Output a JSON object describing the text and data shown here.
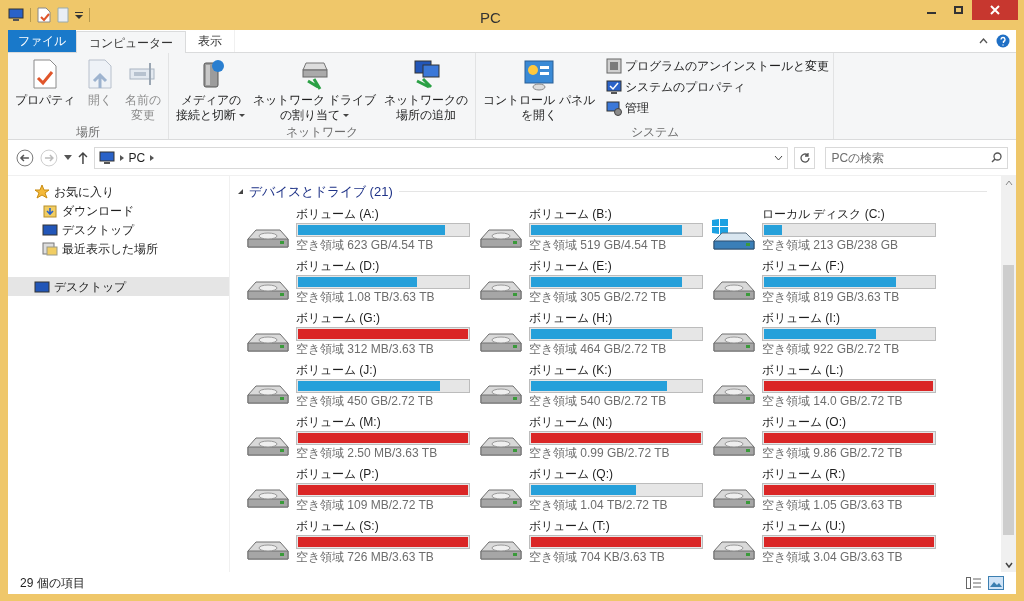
{
  "window": {
    "title": "PC"
  },
  "ribbon": {
    "tabs": [
      {
        "label": "ファイル",
        "kind": "file",
        "selected": false
      },
      {
        "label": "コンピューター",
        "kind": "tab",
        "selected": true
      },
      {
        "label": "表示",
        "kind": "tab",
        "selected": false
      }
    ],
    "groups": [
      {
        "label": "場所",
        "items": [
          {
            "lines": [
              "プロパティ"
            ],
            "kind": "large",
            "disabled": false,
            "dropdown": false
          },
          {
            "lines": [
              "開く"
            ],
            "kind": "large",
            "disabled": true,
            "dropdown": false
          },
          {
            "lines": [
              "名前の",
              "変更"
            ],
            "kind": "large",
            "disabled": true,
            "dropdown": false
          }
        ]
      },
      {
        "label": "ネットワーク",
        "items": [
          {
            "lines": [
              "メディアの",
              "接続と切断"
            ],
            "kind": "large",
            "disabled": false,
            "dropdown": true
          },
          {
            "lines": [
              "ネットワーク ドライブ",
              "の割り当て"
            ],
            "kind": "large",
            "disabled": false,
            "dropdown": true
          },
          {
            "lines": [
              "ネットワークの",
              "場所の追加"
            ],
            "kind": "large",
            "disabled": false,
            "dropdown": false
          }
        ]
      },
      {
        "label": "システム",
        "items": [
          {
            "lines": [
              "コントロール パネル",
              "を開く"
            ],
            "kind": "large",
            "disabled": false,
            "dropdown": false
          },
          {
            "lines": [
              "プログラムのアンインストールと変更"
            ],
            "kind": "small",
            "disabled": false,
            "dropdown": false
          },
          {
            "lines": [
              "システムのプロパティ"
            ],
            "kind": "small",
            "disabled": false,
            "dropdown": false
          },
          {
            "lines": [
              "管理"
            ],
            "kind": "small",
            "disabled": false,
            "dropdown": false
          }
        ]
      }
    ]
  },
  "address_bar": {
    "path": [
      "PC"
    ]
  },
  "search": {
    "placeholder": "PCの検索"
  },
  "nav_pane": {
    "items": [
      {
        "label": "お気に入り",
        "selected": false,
        "children": [
          {
            "label": "ダウンロード",
            "selected": false
          },
          {
            "label": "デスクトップ",
            "selected": false
          },
          {
            "label": "最近表示した場所",
            "selected": false
          }
        ]
      },
      {
        "label": "デスクトップ",
        "selected": true
      }
    ]
  },
  "section": {
    "title": "デバイスとドライブ (21)",
    "expanded": true
  },
  "drives": [
    {
      "kind": "disk",
      "name": "ボリューム (A:)",
      "level": 0.863,
      "color": "#26a0da",
      "free": "空き領域 623 GB/4.54 TB"
    },
    {
      "kind": "disk",
      "name": "ボリューム (B:)",
      "level": 0.886,
      "color": "#26a0da",
      "free": "空き領域 519 GB/4.54 TB"
    },
    {
      "kind": "system",
      "name": "ローカル ディスク (C:)",
      "level": 0.105,
      "color": "#26a0da",
      "free": "空き領域 213 GB/238 GB"
    },
    {
      "kind": "disk",
      "name": "ボリューム (D:)",
      "level": 0.7,
      "color": "#26a0da",
      "free": "空き領域 1.08 TB/3.63 TB"
    },
    {
      "kind": "disk",
      "name": "ボリューム (E:)",
      "level": 0.888,
      "color": "#26a0da",
      "free": "空き領域 305 GB/2.72 TB"
    },
    {
      "kind": "disk",
      "name": "ボリューム (F:)",
      "level": 0.774,
      "color": "#26a0da",
      "free": "空き領域 819 GB/3.63 TB"
    },
    {
      "kind": "disk",
      "name": "ボリューム (G:)",
      "level": 1.0,
      "color": "#da2626",
      "free": "空き領域 312 MB/3.63 TB"
    },
    {
      "kind": "disk",
      "name": "ボリューム (H:)",
      "level": 0.829,
      "color": "#26a0da",
      "free": "空き領域 464 GB/2.72 TB"
    },
    {
      "kind": "disk",
      "name": "ボリューム (I:)",
      "level": 0.661,
      "color": "#26a0da",
      "free": "空き領域 922 GB/2.72 TB"
    },
    {
      "kind": "disk",
      "name": "ボリューム (J:)",
      "level": 0.835,
      "color": "#26a0da",
      "free": "空き領域 450 GB/2.72 TB"
    },
    {
      "kind": "disk",
      "name": "ボリューム (K:)",
      "level": 0.8,
      "color": "#26a0da",
      "free": "空き領域 540 GB/2.72 TB"
    },
    {
      "kind": "disk",
      "name": "ボリューム (L:)",
      "level": 0.995,
      "color": "#da2626",
      "free": "空き領域 14.0 GB/2.72 TB"
    },
    {
      "kind": "disk",
      "name": "ボリューム (M:)",
      "level": 0.999,
      "color": "#da2626",
      "free": "空き領域 2.50 MB/3.63 TB"
    },
    {
      "kind": "disk",
      "name": "ボリューム (N:)",
      "level": 1.0,
      "color": "#da2626",
      "free": "空き領域 0.99 GB/2.72 TB"
    },
    {
      "kind": "disk",
      "name": "ボリューム (O:)",
      "level": 0.996,
      "color": "#da2626",
      "free": "空き領域 9.86 GB/2.72 TB"
    },
    {
      "kind": "disk",
      "name": "ボリューム (P:)",
      "level": 1.0,
      "color": "#da2626",
      "free": "空き領域 109 MB/2.72 TB"
    },
    {
      "kind": "disk",
      "name": "ボリューム (Q:)",
      "level": 0.618,
      "color": "#26a0da",
      "free": "空き領域 1.04 TB/2.72 TB"
    },
    {
      "kind": "disk",
      "name": "ボリューム (R:)",
      "level": 1.0,
      "color": "#da2626",
      "free": "空き領域 1.05 GB/3.63 TB"
    },
    {
      "kind": "disk",
      "name": "ボリューム (S:)",
      "level": 1.0,
      "color": "#da2626",
      "free": "空き領域 726 MB/3.63 TB"
    },
    {
      "kind": "disk",
      "name": "ボリューム (T:)",
      "level": 1.0,
      "color": "#da2626",
      "free": "空き領域 704 KB/3.63 TB"
    },
    {
      "kind": "disk",
      "name": "ボリューム (U:)",
      "level": 0.999,
      "color": "#da2626",
      "free": "空き領域 3.04 GB/3.63 TB"
    }
  ],
  "status_bar": {
    "count": "29 個の項目"
  }
}
